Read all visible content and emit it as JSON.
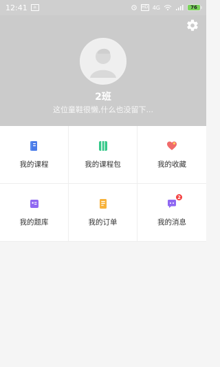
{
  "status_bar": {
    "time": "12:41",
    "battery": "76",
    "network_text": "4G"
  },
  "profile": {
    "name": "2班",
    "bio": "这位童鞋很懒,什么也没留下..."
  },
  "menu": [
    {
      "label": "我的课程",
      "icon": "book-icon",
      "color": "#5b8def"
    },
    {
      "label": "我的课程包",
      "icon": "package-icon",
      "color": "#35c889"
    },
    {
      "label": "我的收藏",
      "icon": "heart-icon",
      "color": "#f06a6a"
    },
    {
      "label": "我的题库",
      "icon": "question-bank-icon",
      "color": "#8f68f2"
    },
    {
      "label": "我的订单",
      "icon": "order-icon",
      "color": "#f7b23b"
    },
    {
      "label": "我的消息",
      "icon": "message-icon",
      "color": "#8f68f2",
      "badge": "2"
    }
  ]
}
